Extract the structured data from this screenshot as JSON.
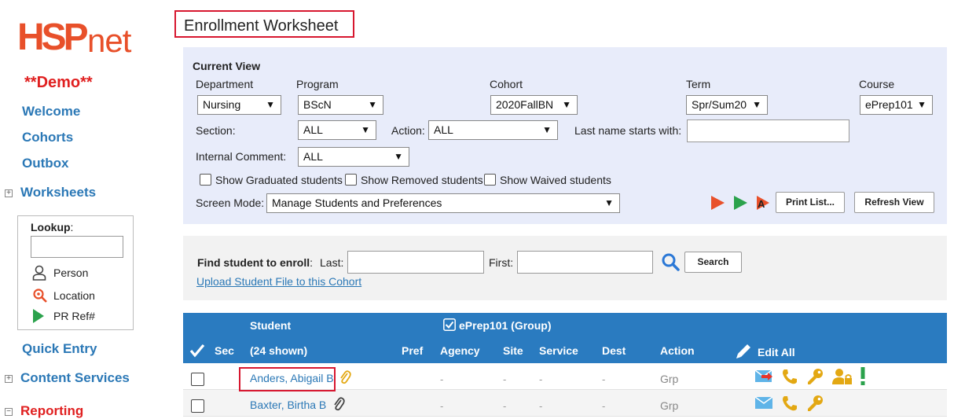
{
  "sidebar": {
    "logo": {
      "main": "HSP",
      "suffix": "net"
    },
    "demo": "**Demo**",
    "links": {
      "welcome": "Welcome",
      "cohorts": "Cohorts",
      "outbox": "Outbox"
    },
    "worksheets": "Worksheets",
    "lookup": {
      "label": "Lookup",
      "colon": ":",
      "person": "Person",
      "location": "Location",
      "pr_ref": "PR Ref#"
    },
    "quick_entry": "Quick Entry",
    "content_services": "Content Services",
    "reporting": "Reporting"
  },
  "page_title": "Enrollment Worksheet",
  "current_view": {
    "heading": "Current View",
    "department": {
      "label": "Department",
      "value": "Nursing"
    },
    "program": {
      "label": "Program",
      "value": "BScN"
    },
    "cohort": {
      "label": "Cohort",
      "value": "2020FallBN"
    },
    "term": {
      "label": "Term",
      "value": "Spr/Sum20"
    },
    "course": {
      "label": "Course",
      "value": "ePrep101"
    },
    "section": {
      "label": "Section:",
      "value": "ALL"
    },
    "action": {
      "label": "Action:",
      "value": "ALL"
    },
    "last_name": {
      "label": "Last name starts with:",
      "value": ""
    },
    "internal_comment": {
      "label": "Internal Comment:",
      "value": "ALL"
    },
    "checkboxes": {
      "graduated": "Show Graduated students",
      "removed": "Show Removed students",
      "waived": "Show Waived students"
    },
    "screen_mode": {
      "label": "Screen Mode:",
      "value": "Manage Students and Preferences"
    },
    "print_button": "Print List...",
    "refresh_button": "Refresh View"
  },
  "find": {
    "label": "Find student to enroll",
    "colon": ":",
    "last_label": "Last:",
    "first_label": "First:",
    "search_button": "Search",
    "upload_link": "Upload Student File to this Cohort"
  },
  "table": {
    "headers": {
      "sec": "Sec",
      "student": "Student",
      "shown": "(24 shown)",
      "group": "ePrep101  (Group)",
      "pref": "Pref",
      "agency": "Agency",
      "site": "Site",
      "service": "Service",
      "dest": "Dest",
      "action": "Action",
      "edit_all": "Edit All"
    },
    "rows": [
      {
        "name": "Anders, Abigail B",
        "agency": "-",
        "site": "-",
        "service": "-",
        "dest": "-",
        "action": "Grp"
      },
      {
        "name": "Baxter, Birtha B",
        "agency": "-",
        "site": "-",
        "service": "-",
        "dest": "-",
        "action": "Grp"
      }
    ]
  },
  "colors": {
    "accent": "#2b78b6",
    "brand": "#e8502a",
    "header_bg": "#2a7bc0",
    "highlight": "#d7172f",
    "panel_bg": "#e8ecfa"
  }
}
